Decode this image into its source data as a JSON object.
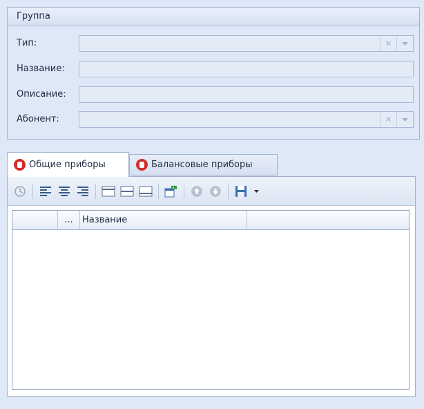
{
  "group": {
    "title": "Группа",
    "fields": {
      "type_label": "Тип:",
      "name_label": "Название:",
      "description_label": "Описание:",
      "subscriber_label": "Абонент:",
      "type_value": "",
      "name_value": "",
      "description_value": "",
      "subscriber_value": ""
    }
  },
  "tabs": [
    {
      "label": "Общие приборы",
      "active": true
    },
    {
      "label": "Балансовые приборы",
      "active": false
    }
  ],
  "grid": {
    "columns": [
      "",
      "...",
      "Название",
      ""
    ],
    "rows": []
  },
  "colors": {
    "background": "#dfe8f6",
    "accent_red": "#d62b2b",
    "border": "#9fb2cf"
  },
  "icons": [
    "clear-icon",
    "dropdown-arrow-icon",
    "refresh-icon",
    "align-left-icon",
    "align-center-icon",
    "align-right-icon",
    "row-layout-icon",
    "export-icon",
    "move-up-icon",
    "move-down-icon",
    "save-icon"
  ]
}
